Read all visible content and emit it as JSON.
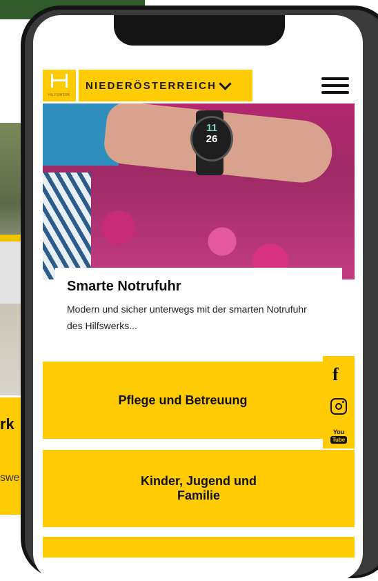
{
  "background_site": {
    "heading_fragment": "rk",
    "text_fragment": "swe"
  },
  "header": {
    "logo_text": "HILFSWERK",
    "region": "NIEDERÖSTERREICH"
  },
  "hero": {
    "watch_hour": "11",
    "watch_minute": "26"
  },
  "teaser": {
    "title": "Smarte Notrufuhr",
    "text": "Modern und sicher unterwegs mit der smarten Notrufuhr des Hilfswerks..."
  },
  "tiles": [
    {
      "label": "Pflege und Betreuung"
    },
    {
      "label": "Kinder, Jugend und Familie"
    }
  ],
  "social": {
    "facebook": "f",
    "youtube_you": "You",
    "youtube_tube": "Tube"
  },
  "colors": {
    "brand_yellow": "#ffcb05",
    "phone_frame": "#141414"
  }
}
